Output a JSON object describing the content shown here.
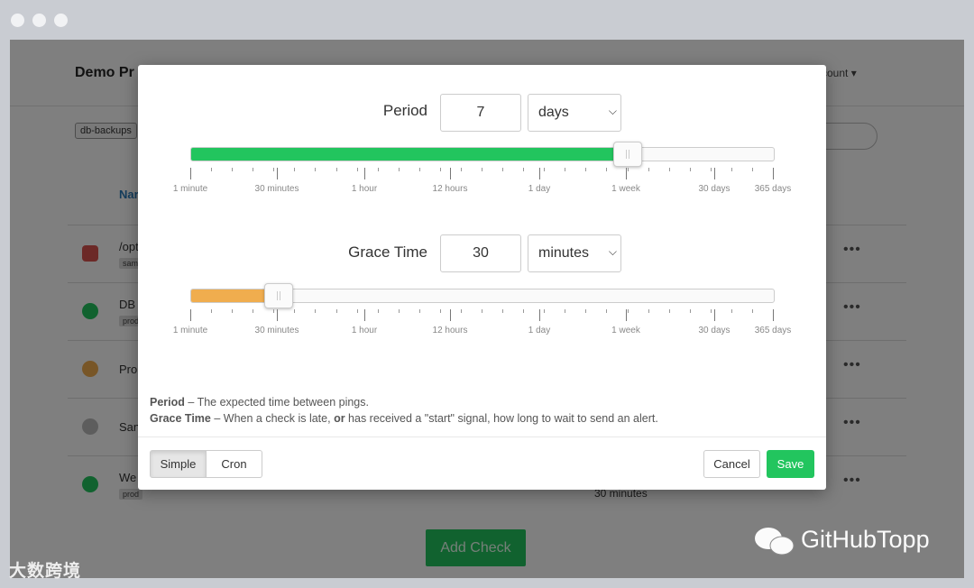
{
  "background": {
    "brand": "Demo Pr",
    "account": "count ▾",
    "tag": "db-backups",
    "column_header": "Nar",
    "rows": [
      {
        "name": "/opt",
        "tag": "sam",
        "status": "down"
      },
      {
        "name": "DB",
        "tag": "prod",
        "status": "up"
      },
      {
        "name": "Pro",
        "tag": "",
        "status": "grace"
      },
      {
        "name": "San",
        "tag": "",
        "status": "paused"
      },
      {
        "name": "We",
        "tag": "prod",
        "status": "up"
      }
    ],
    "row_more": "•••",
    "partial_text": "30 minutes",
    "add_check": "Add Check"
  },
  "modal": {
    "period": {
      "label": "Period",
      "value": "7",
      "unit": "days",
      "slider_fraction": 0.747,
      "color": "#22c55e"
    },
    "grace": {
      "label": "Grace Time",
      "value": "30",
      "unit": "minutes",
      "slider_fraction": 0.148,
      "color": "#f0ad4e"
    },
    "tick_labels": [
      "1 minute",
      "30 minutes",
      "1 hour",
      "12 hours",
      "1 day",
      "1 week",
      "30 days",
      "365 days"
    ],
    "help": {
      "period_term": "Period",
      "period_text": " – The expected time between pings.",
      "grace_term": "Grace Time",
      "grace_text_1": " – When a check is late, ",
      "grace_or": "or",
      "grace_text_2": " has received a \"start\" signal, how long to wait to send an alert."
    },
    "footer": {
      "simple": "Simple",
      "cron": "Cron",
      "cancel": "Cancel",
      "save": "Save"
    }
  },
  "watermark": {
    "left": "大数跨境",
    "right": "GitHubTopp"
  }
}
